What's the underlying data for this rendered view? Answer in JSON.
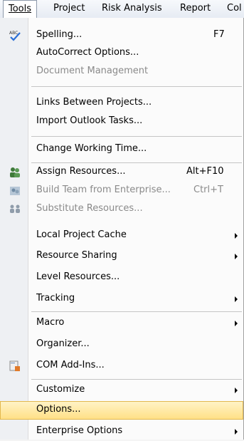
{
  "menubar": {
    "tools": "Tools",
    "project": "Project",
    "risk": "Risk Analysis",
    "report": "Report",
    "col": "Col"
  },
  "menu": {
    "spelling": {
      "label": "Spelling...",
      "shortcut": "F7"
    },
    "autocorrect": {
      "label": "AutoCorrect Options..."
    },
    "docmgmt": {
      "label": "Document Management"
    },
    "links": {
      "label": "Links Between Projects..."
    },
    "outlook": {
      "label": "Import Outlook Tasks..."
    },
    "worktime": {
      "label": "Change Working Time..."
    },
    "assign": {
      "label": "Assign Resources...",
      "shortcut": "Alt+F10"
    },
    "buildteam": {
      "label": "Build Team from Enterprise...",
      "shortcut": "Ctrl+T"
    },
    "substitute": {
      "label": "Substitute Resources..."
    },
    "cache": {
      "label": "Local Project Cache"
    },
    "sharing": {
      "label": "Resource Sharing"
    },
    "level": {
      "label": "Level Resources..."
    },
    "tracking": {
      "label": "Tracking"
    },
    "macro": {
      "label": "Macro"
    },
    "organizer": {
      "label": "Organizer..."
    },
    "com": {
      "label": "COM Add-Ins..."
    },
    "customize": {
      "label": "Customize"
    },
    "options": {
      "label": "Options..."
    },
    "enterprise": {
      "label": "Enterprise Options"
    }
  },
  "colors": {
    "highlight": "#ffe087",
    "disabled_text": "#8a8a8a"
  }
}
